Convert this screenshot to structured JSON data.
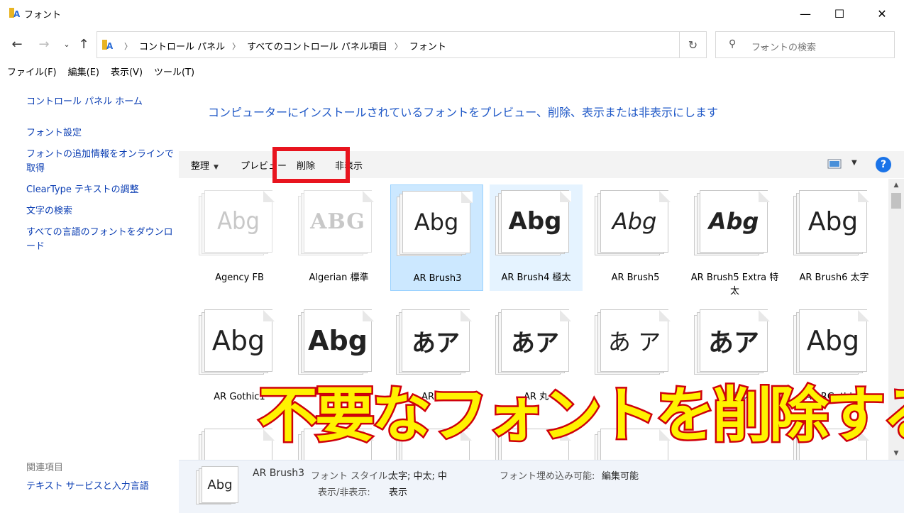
{
  "window": {
    "title": "フォント"
  },
  "address": {
    "crumbs": [
      "コントロール パネル",
      "すべてのコントロール パネル項目",
      "フォント"
    ],
    "search_placeholder": "フォントの検索"
  },
  "menu": [
    "ファイル(F)",
    "編集(E)",
    "表示(V)",
    "ツール(T)"
  ],
  "left": {
    "home": "コントロール パネル ホーム",
    "links": [
      "フォント設定",
      "フォントの追加情報をオンラインで取得",
      "ClearType テキストの調整",
      "文字の検索",
      "すべての言語のフォントをダウンロード"
    ],
    "related_heading": "関連項目",
    "related": [
      "テキスト サービスと入力言語"
    ]
  },
  "main": {
    "heading": "コンピューターにインストールされているフォントをプレビュー、削除、表示または非表示にします",
    "commands": {
      "organize": "整理",
      "preview": "プレビュー",
      "delete": "削除",
      "hide": "非表示"
    },
    "help": "?"
  },
  "fonts": [
    {
      "name": "Agency FB",
      "sample": "Abg",
      "state": "faded"
    },
    {
      "name": "Algerian 標準",
      "sample": "ABG",
      "state": "faded"
    },
    {
      "name": "AR Brush3",
      "sample": "Abg",
      "state": "selected"
    },
    {
      "name": "AR Brush4 極太",
      "sample": "Abg",
      "state": "hover"
    },
    {
      "name": "AR Brush5",
      "sample": "Abg",
      "state": "normal"
    },
    {
      "name": "AR Brush5 Extra 特太",
      "sample": "Abg",
      "state": "normal"
    },
    {
      "name": "AR Brush6 太字",
      "sample": "Abg",
      "state": "normal"
    },
    {
      "name": "AR Gothic1",
      "sample": "Abg",
      "state": "normal"
    },
    {
      "name": "AR C",
      "sample": "Abg",
      "state": "normal"
    },
    {
      "name": "AR Pゴ",
      "sample": "あア",
      "state": "normal"
    },
    {
      "name": "AR 丸",
      "sample": "あア",
      "state": "normal"
    },
    {
      "name": "",
      "sample": "あ ア",
      "state": "normal"
    },
    {
      "name": "AR 藝体",
      "sample": "あア",
      "state": "normal"
    },
    {
      "name": "AR RGothic1",
      "sample": "Abg",
      "state": "normal"
    }
  ],
  "details": {
    "name": "AR Brush3",
    "thumb_sample": "Abg",
    "style_label": "フォント スタイル:",
    "style_value": "太字; 中太; 中",
    "visibility_label": "表示/非表示:",
    "visibility_value": "表示",
    "embed_label": "フォント埋め込み可能:",
    "embed_value": "編集可能"
  },
  "overlay": {
    "caption": "不要なフォントを削除する"
  },
  "colors": {
    "link": "#0a3db3",
    "heading": "#1f58c7",
    "highlight": "#e8141e",
    "caption_fill": "#fff200",
    "caption_stroke": "#d4000d"
  }
}
